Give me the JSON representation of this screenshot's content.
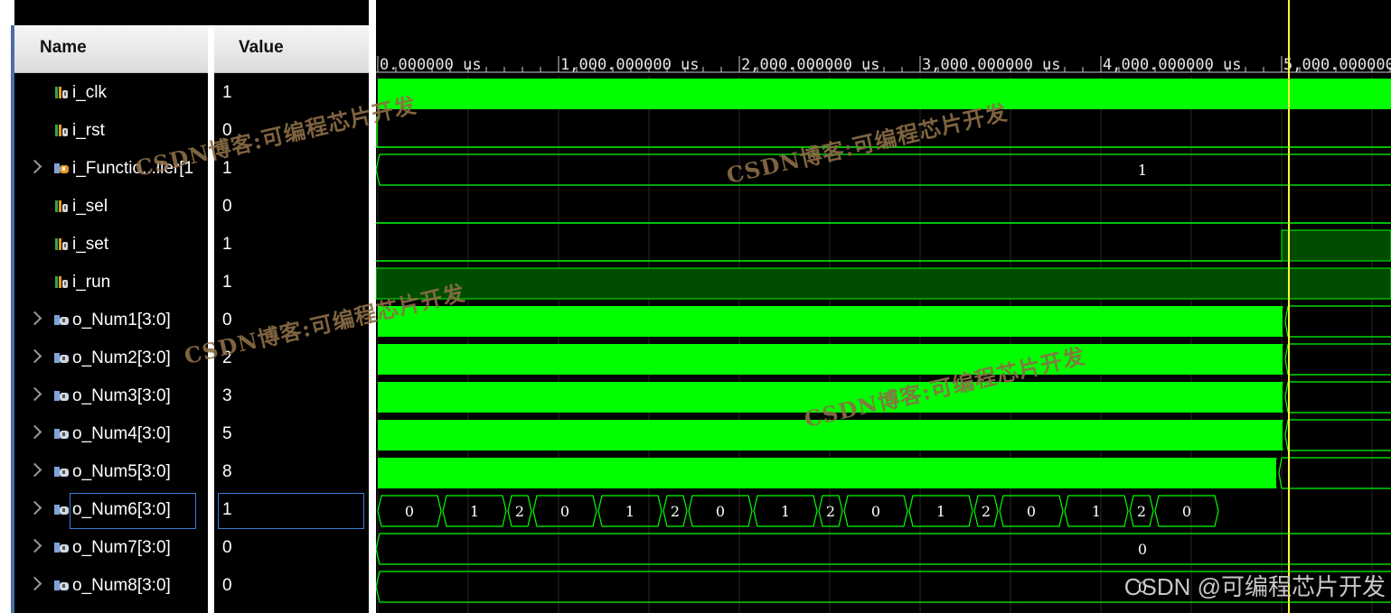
{
  "header": {
    "name_label": "Name",
    "value_label": "Value"
  },
  "timeline": {
    "unit": "us",
    "ticks": [
      "0.000000 us",
      "1,000.000000 us",
      "2,000.000000 us",
      "3,000.000000 us",
      "4,000.000000 us",
      "5,000.000000"
    ],
    "cursor_time": 5.04
  },
  "signals": [
    {
      "name": "i_clk",
      "value": "1",
      "kind": "bit",
      "expandable": false
    },
    {
      "name": "i_rst",
      "value": "0",
      "kind": "bit",
      "expandable": false
    },
    {
      "name": "i_Functio...ller[1",
      "value": "1",
      "kind": "bus-in",
      "expandable": true
    },
    {
      "name": "i_sel",
      "value": "0",
      "kind": "bit",
      "expandable": false
    },
    {
      "name": "i_set",
      "value": "1",
      "kind": "bit",
      "expandable": false
    },
    {
      "name": "i_run",
      "value": "1",
      "kind": "bit",
      "expandable": false
    },
    {
      "name": "o_Num1[3:0]",
      "value": "0",
      "kind": "bus",
      "expandable": true
    },
    {
      "name": "o_Num2[3:0]",
      "value": "2",
      "kind": "bus",
      "expandable": true
    },
    {
      "name": "o_Num3[3:0]",
      "value": "3",
      "kind": "bus",
      "expandable": true
    },
    {
      "name": "o_Num4[3:0]",
      "value": "5",
      "kind": "bus",
      "expandable": true
    },
    {
      "name": "o_Num5[3:0]",
      "value": "8",
      "kind": "bus",
      "expandable": true
    },
    {
      "name": "o_Num6[3:0]",
      "value": "1",
      "kind": "bus",
      "expandable": true,
      "selected": true
    },
    {
      "name": "o_Num7[3:0]",
      "value": "0",
      "kind": "bus",
      "expandable": true
    },
    {
      "name": "o_Num8[3:0]",
      "value": "0",
      "kind": "bus",
      "expandable": true
    }
  ],
  "waves": {
    "i_rst_low_label": "",
    "i_func_bus_label": "1",
    "o_Num6_segments": [
      "0",
      "1",
      "2",
      "0",
      "1",
      "2",
      "0",
      "1",
      "2",
      "0",
      "1",
      "2",
      "0",
      "1",
      "2",
      "0"
    ],
    "o_Num7_label": "0",
    "o_Num8_label": "0"
  },
  "watermark": "CSDN博客:可编程芯片开发",
  "credit": "CSDN @可编程芯片开发",
  "colors": {
    "wave_green": "#00ff00",
    "dark_green": "#004d00",
    "cursor": "#ffff33",
    "grid": "#2a2a2a"
  }
}
